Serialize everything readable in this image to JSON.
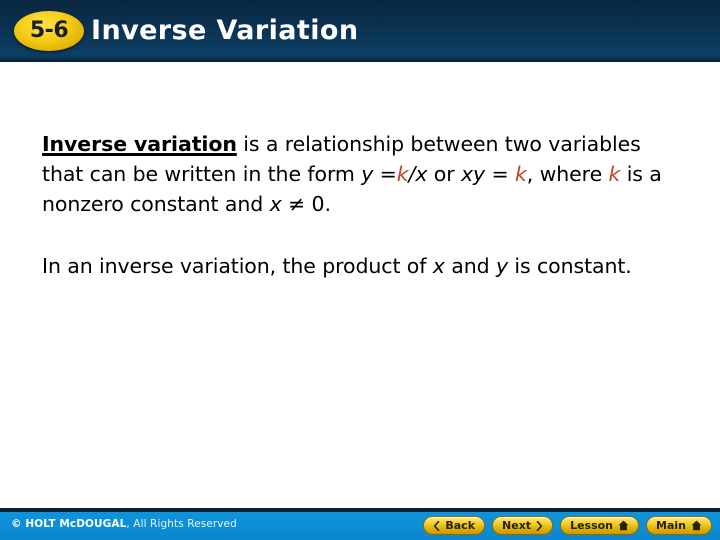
{
  "header": {
    "badge_number": "5-6",
    "title": "Inverse Variation",
    "background_color": "#0a3050",
    "badge_color": "#f3cc1a",
    "title_color": "#ffffff"
  },
  "content": {
    "paragraph_1": {
      "term": "Inverse variation",
      "segment_1": " is a relationship between two variables that can be written in the form ",
      "var_y": "y",
      "segment_2": " =",
      "var_k1": "k",
      "segment_3": "/",
      "var_x1": "x",
      "segment_4": " or ",
      "var_xy": "xy",
      "segment_5": " = ",
      "var_k2": "k",
      "segment_6": ", where ",
      "var_k3": "k",
      "segment_7": " is a nonzero constant and ",
      "var_x2": "x",
      "segment_8": " ≠ 0."
    },
    "paragraph_2": {
      "segment_1": "In an inverse variation, the product of ",
      "var_x": "x",
      "segment_2": " and ",
      "var_y": "y",
      "segment_3": " is constant."
    },
    "variable_color": "#c2452a",
    "text_color": "#000000"
  },
  "footer": {
    "copyright_brand": "© HOLT McDOUGAL",
    "copyright_rest": ", All Rights Reserved",
    "background_color": "#0d8ed6",
    "buttons": [
      {
        "label": "Back",
        "icon": "chevron-left-icon",
        "icon_side": "left"
      },
      {
        "label": "Next",
        "icon": "chevron-right-icon",
        "icon_side": "right"
      },
      {
        "label": "Lesson",
        "icon": "home-icon",
        "icon_side": "right"
      },
      {
        "label": "Main",
        "icon": "home-icon",
        "icon_side": "right"
      }
    ]
  }
}
